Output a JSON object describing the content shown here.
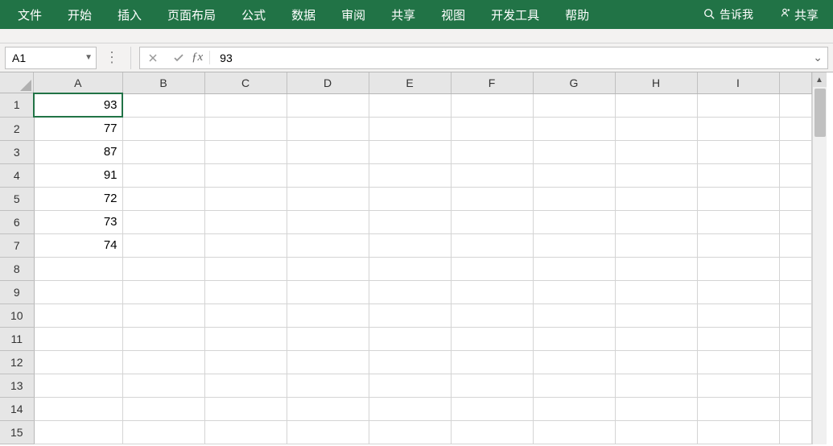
{
  "ribbon": {
    "tabs": [
      "文件",
      "开始",
      "插入",
      "页面布局",
      "公式",
      "数据",
      "审阅",
      "共享",
      "视图",
      "开发工具",
      "帮助"
    ],
    "tell_me": "告诉我",
    "share": "共享"
  },
  "formula_bar": {
    "name_box": "A1",
    "formula_value": "93"
  },
  "grid": {
    "columns": [
      "A",
      "B",
      "C",
      "D",
      "E",
      "F",
      "G",
      "H",
      "I"
    ],
    "rows": [
      1,
      2,
      3,
      4,
      5,
      6,
      7,
      8,
      9,
      10,
      11,
      12,
      13,
      14,
      15
    ],
    "cells": {
      "A1": "93",
      "A2": "77",
      "A3": "87",
      "A4": "91",
      "A5": "72",
      "A6": "73",
      "A7": "74"
    },
    "selected": "A1"
  }
}
